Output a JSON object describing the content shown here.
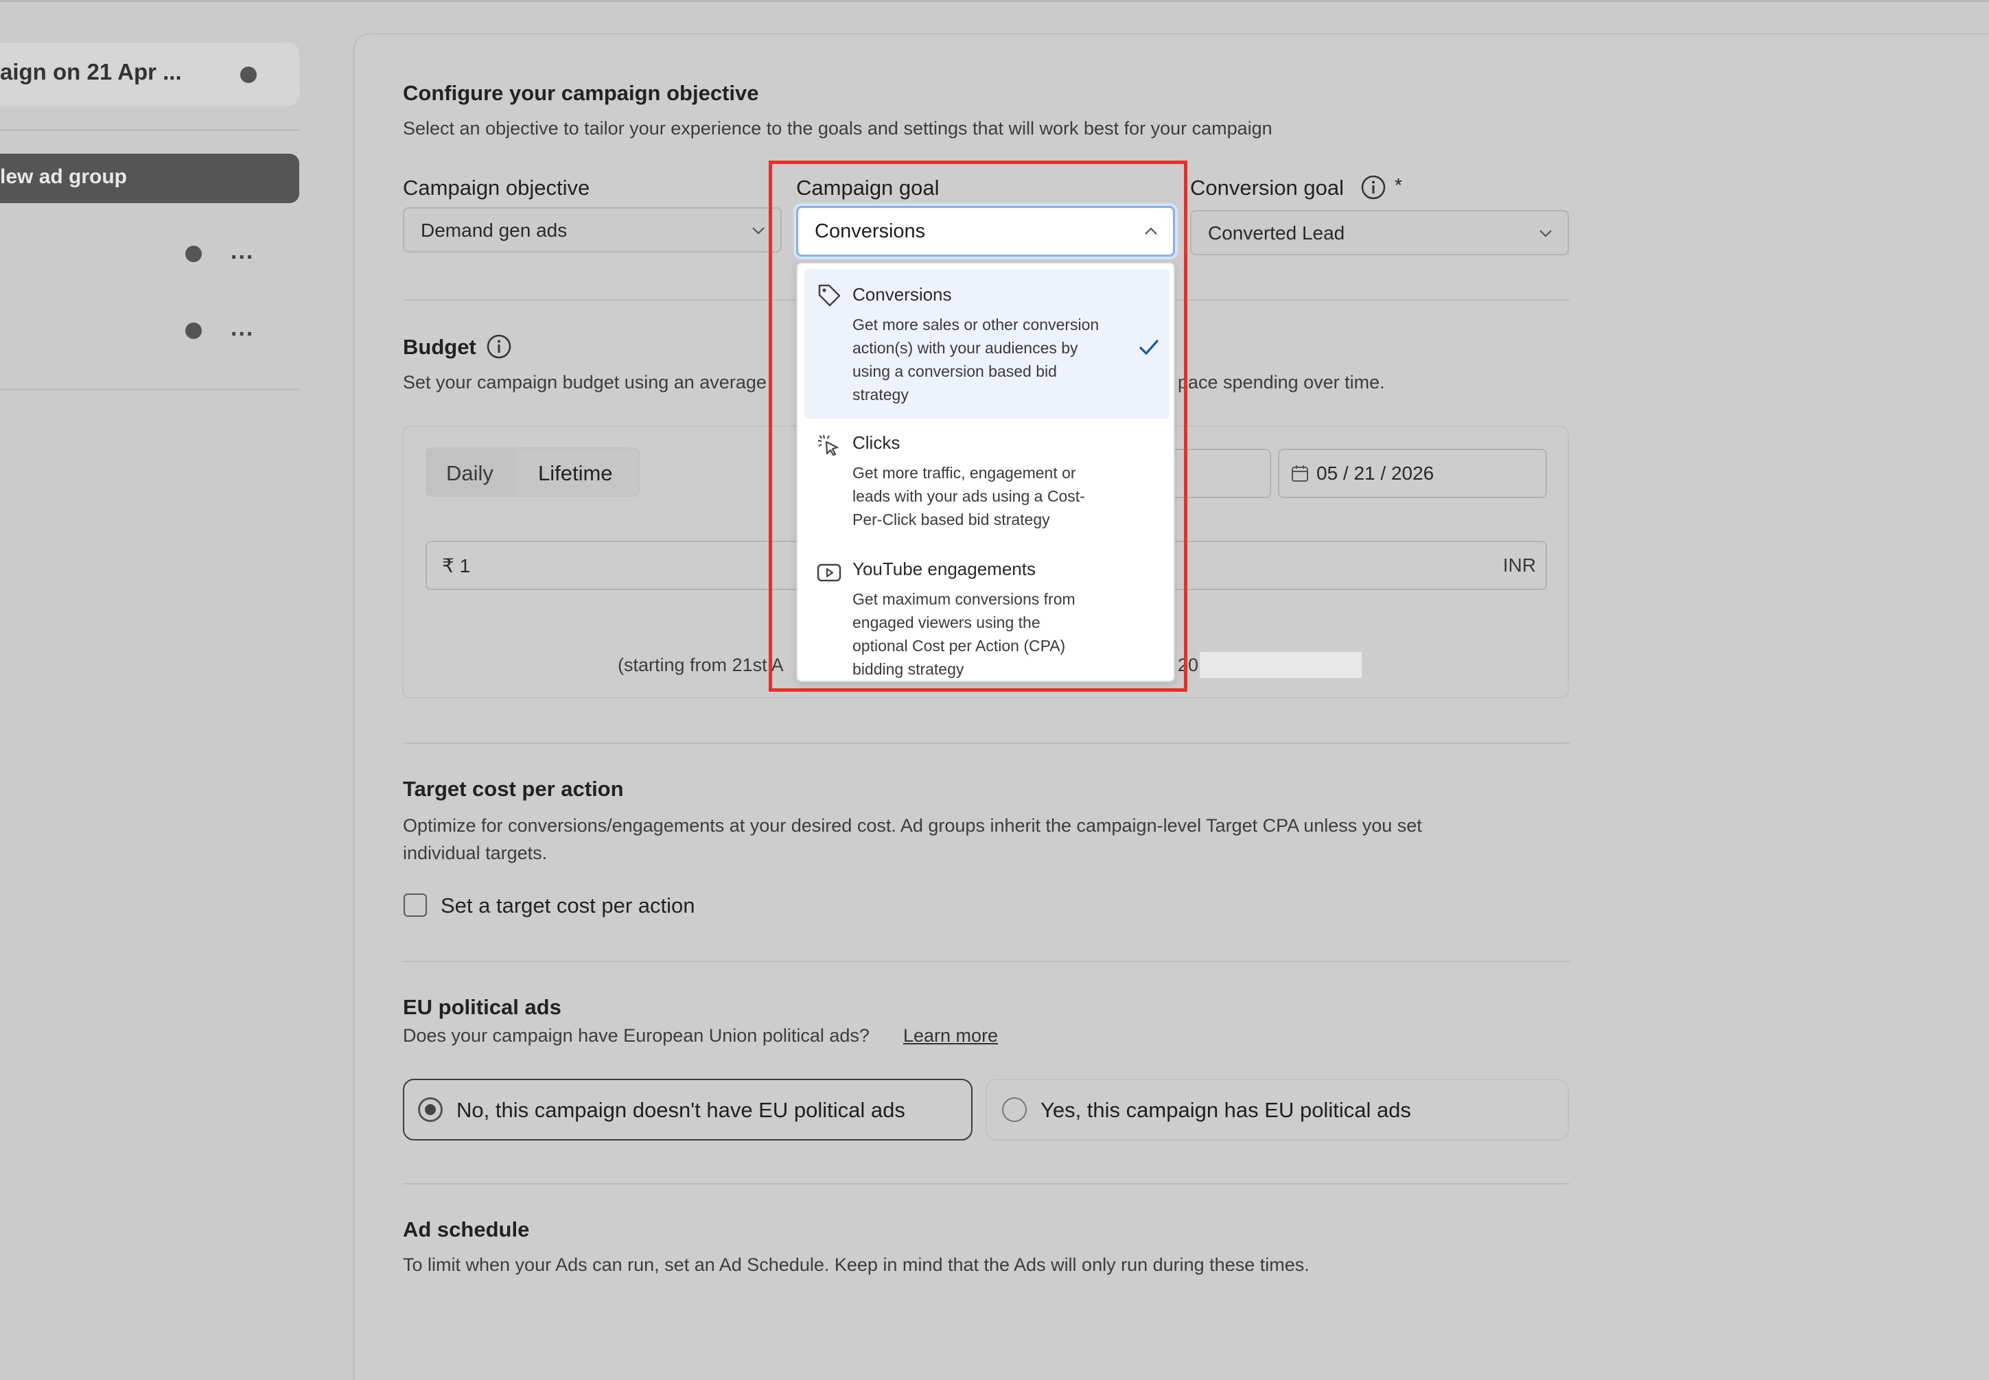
{
  "sidebar": {
    "campaign_label": "aign on 21 Apr ...",
    "new_ad_group_label": "lew ad group",
    "more_label": "..."
  },
  "objective_section": {
    "title": "Configure your campaign objective",
    "description": "Select an objective to tailor your experience to the goals and settings that will work best for your campaign",
    "campaign_objective_label": "Campaign objective",
    "campaign_objective_value": "Demand gen ads",
    "campaign_goal_label": "Campaign goal",
    "campaign_goal_value": "Conversions",
    "conversion_goal_label": "Conversion goal",
    "conversion_goal_required": "*",
    "conversion_goal_value": "Converted Lead"
  },
  "campaign_goal_menu": {
    "options": [
      {
        "title": "Conversions",
        "desc": [
          "Get more sales or other conversion",
          "action(s) with your audiences by",
          "using a conversion based bid",
          "strategy"
        ],
        "icon": "tag-icon",
        "selected": true
      },
      {
        "title": "Clicks",
        "desc": [
          "Get more traffic, engagement or",
          "leads with your ads using a Cost-",
          "Per-Click based bid strategy"
        ],
        "icon": "cursor-click-icon",
        "selected": false
      },
      {
        "title": "YouTube engagements",
        "desc": [
          "Get maximum conversions from",
          "engaged viewers using the",
          "optional Cost per Action (CPA)",
          "bidding strategy"
        ],
        "icon": "youtube-icon",
        "selected": false
      }
    ]
  },
  "budget_section": {
    "title": "Budget",
    "description_left": "Set your campaign budget using an average",
    "description_right": "pace spending over time.",
    "tab_daily": "Daily",
    "tab_lifetime": "Lifetime",
    "end_date": "05 / 21 / 2026",
    "amount_value": "₹ 1",
    "currency": "INR",
    "note_left": "(starting from 21st A",
    "note_right": "20"
  },
  "target_cpa_section": {
    "title": "Target cost per action",
    "description_line1": "Optimize for conversions/engagements at your desired cost. Ad groups inherit the campaign-level Target CPA unless you set",
    "description_line2": "individual targets.",
    "checkbox_label": "Set a target cost per action"
  },
  "eu_section": {
    "title": "EU political ads",
    "description": "Does your campaign have European Union political ads?",
    "learn_more": "Learn more",
    "option_no": "No, this campaign doesn't have EU political ads",
    "option_yes": "Yes, this campaign has EU political ads"
  },
  "schedule_section": {
    "title": "Ad schedule",
    "description": "To limit when your Ads can run, set an Ad Schedule. Keep in mind that the Ads will only run during these times."
  },
  "colors": {
    "highlight": "#e8302a",
    "check": "#1a56b0",
    "selected_bg": "#eef2fc"
  }
}
